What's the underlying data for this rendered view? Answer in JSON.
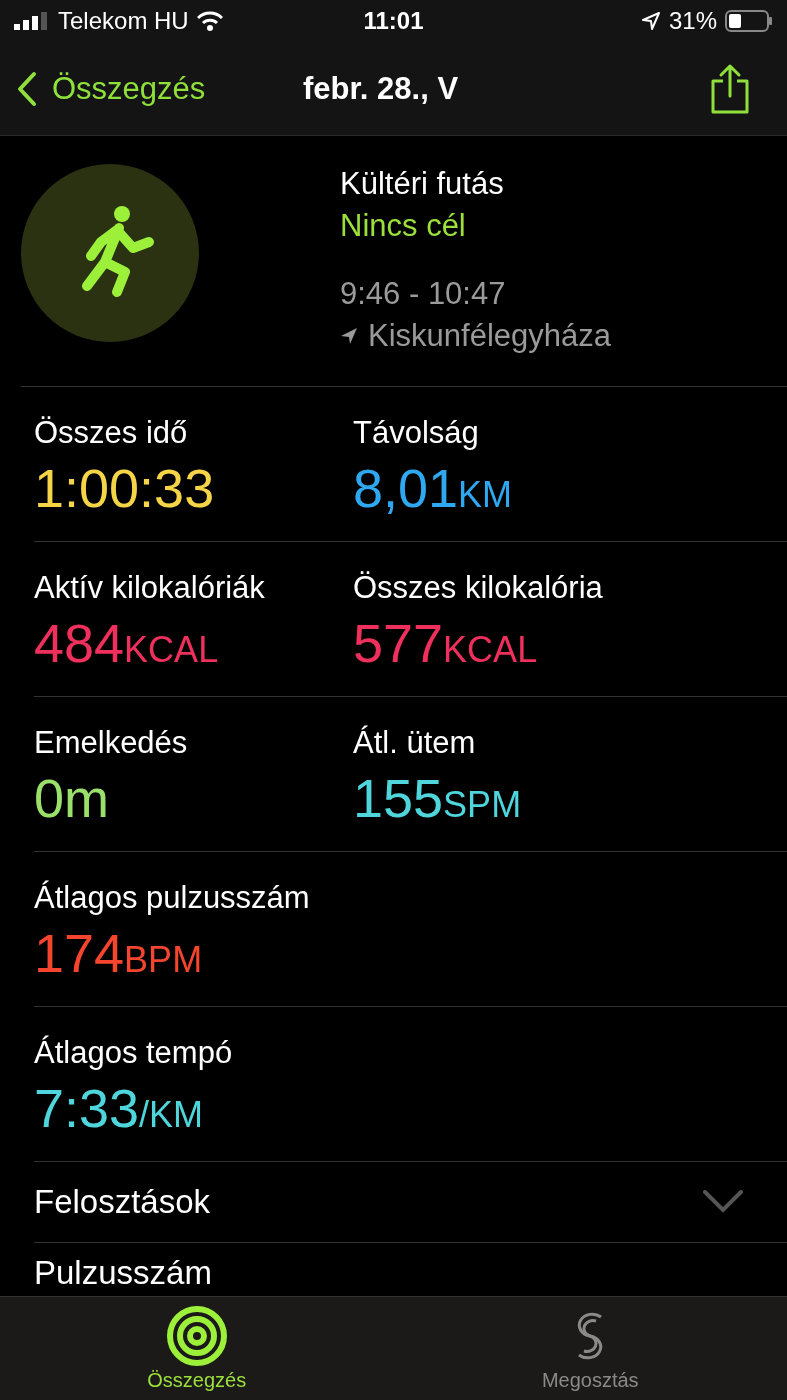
{
  "status_bar": {
    "carrier": "Telekom HU",
    "time": "11:01",
    "battery": "31%"
  },
  "nav": {
    "back": "Összegzés",
    "title": "febr. 28., V"
  },
  "workout": {
    "name": "Kültéri futás",
    "goal": "Nincs cél",
    "time_range": "9:46 - 10:47",
    "location": "Kiskunfélegyháza"
  },
  "metric_rows": [
    [
      {
        "label": "Összes idő",
        "value": "1:00:33",
        "color": "#f5d547"
      },
      {
        "label": "Távolság",
        "value": "8,01",
        "unit": "KM",
        "color": "#2ea8f0"
      }
    ],
    [
      {
        "label": "Aktív kilokalóriák",
        "value": "484",
        "unit": "KCAL",
        "color": "#f0305c"
      },
      {
        "label": "Összes kilokalória",
        "value": "577",
        "unit": "KCAL",
        "color": "#f0305c"
      }
    ],
    [
      {
        "label": "Emelkedés",
        "value": "0m",
        "color": "#9be06a"
      },
      {
        "label": "Átl. ütem",
        "value": "155",
        "unit": "SPM",
        "color": "#4fd6dc"
      }
    ],
    [
      {
        "label": "Átlagos pulzusszám",
        "value": "174",
        "unit": "BPM",
        "color": "#f5452f"
      }
    ],
    [
      {
        "label": "Átlagos tempó",
        "value": "7:33",
        "unit": "/KM",
        "color": "#4fd6dc"
      }
    ]
  ],
  "sections": [
    {
      "label": "Felosztások",
      "expanded": false
    },
    {
      "label": "Pulzusszám"
    }
  ],
  "tabs": [
    {
      "label": "Összegzés",
      "selected": true
    },
    {
      "label": "Megosztás",
      "selected": false
    }
  ]
}
